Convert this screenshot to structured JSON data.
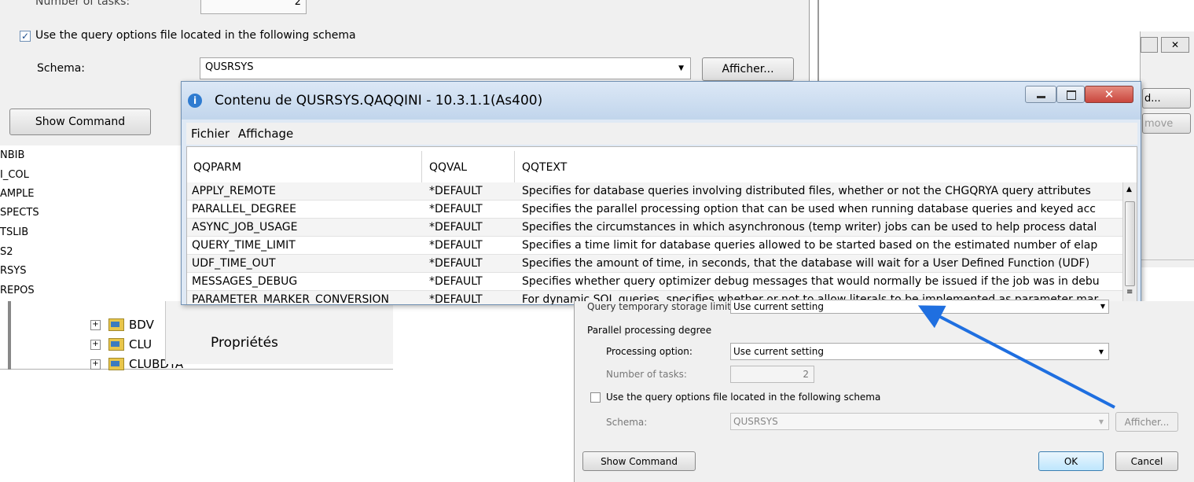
{
  "bg_dialog": {
    "tasks_label": "Number of tasks:",
    "tasks_value": "2",
    "use_file_label": "Use the query options file located in the following schema",
    "schema_label": "Schema:",
    "schema_value": "QUSRSYS",
    "afficher_label": "Afficher...",
    "show_command_label": "Show Command"
  },
  "tree": {
    "items": [
      "NBIB",
      "I_COL",
      "AMPLE",
      "SPECTS",
      "TSLIB",
      "S2",
      "RSYS",
      "REPOS"
    ],
    "folders": [
      "BDV",
      "CLU",
      "CLUBDTA"
    ],
    "expander": "+"
  },
  "context_menu": {
    "item": "Propriétés"
  },
  "right_window": {
    "buttons": [
      "d...",
      "move"
    ]
  },
  "query_window": {
    "title": "Contenu de QUSRSYS.QAQQINI - 10.3.1.1(As400)",
    "menu": [
      "Fichier",
      "Affichage"
    ],
    "columns": [
      "QQPARM",
      "QQVAL",
      "QQTEXT"
    ],
    "rows": [
      {
        "parm": "APPLY_REMOTE",
        "val": "*DEFAULT",
        "text": "Specifies for database queries involving distributed files, whether or not the CHGQRYA query attributes"
      },
      {
        "parm": "PARALLEL_DEGREE",
        "val": "*DEFAULT",
        "text": "Specifies the parallel processing option that can be used when running database queries and keyed acc"
      },
      {
        "parm": "ASYNC_JOB_USAGE",
        "val": "*DEFAULT",
        "text": "Specifies the circumstances in which asynchronous (temp writer) jobs can be used to help process datal"
      },
      {
        "parm": "QUERY_TIME_LIMIT",
        "val": "*DEFAULT",
        "text": "Specifies a time limit for database queries allowed to be started based on the estimated number of elap"
      },
      {
        "parm": "UDF_TIME_OUT",
        "val": "*DEFAULT",
        "text": "Specifies the amount of time, in seconds, that the database will wait for a User Defined Function (UDF)"
      },
      {
        "parm": "MESSAGES_DEBUG",
        "val": "*DEFAULT",
        "text": "Specifies whether query optimizer debug messages that would normally be issued if the job was in debu"
      },
      {
        "parm": "PARAMETER_MARKER_CONVERSION",
        "val": "*DEFAULT",
        "text": "For dynamic SQL queries, specifies whether or not to allow literals to be implemented as parameter mar"
      }
    ]
  },
  "fg_dialog": {
    "storage_label": "Query temporary storage limit:",
    "storage_value": "Use current setting",
    "parallel_header": "Parallel processing degree",
    "processing_label": "Processing option:",
    "processing_value": "Use current setting",
    "tasks_label": "Number of tasks:",
    "tasks_value": "2",
    "use_file_label": "Use the query options file located in the following schema",
    "schema_label": "Schema:",
    "schema_value": "QUSRSYS",
    "afficher_label": "Afficher...",
    "show_command_label": "Show Command",
    "ok_label": "OK",
    "cancel_label": "Cancel"
  },
  "colors": {
    "arrow": "#1f6fe0",
    "titlebar": "#c9dcf0",
    "close": "#c9463d"
  }
}
